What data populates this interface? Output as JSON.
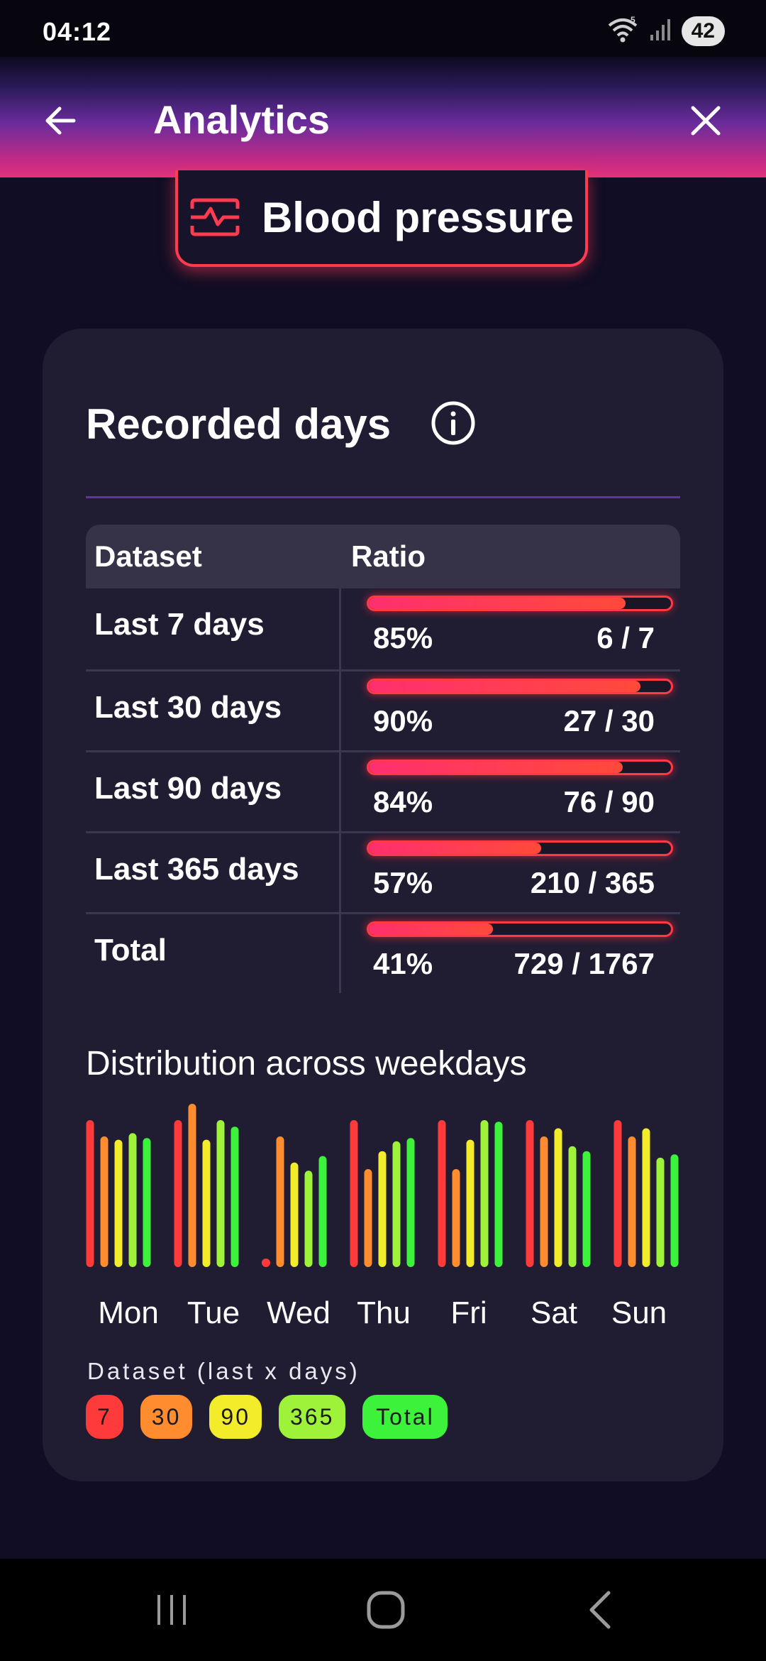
{
  "status": {
    "time": "04:12",
    "battery": "42",
    "wifi_badge": "5"
  },
  "appbar": {
    "title": "Analytics"
  },
  "metric": {
    "label": "Blood pressure",
    "icon": "heart-monitor-icon",
    "accent": "#ff3b4f"
  },
  "recorded": {
    "title": "Recorded days",
    "columns": {
      "dataset": "Dataset",
      "ratio": "Ratio"
    },
    "rows": [
      {
        "name": "Last 7 days",
        "percent": "85%",
        "count": "6 / 7",
        "fraction": 0.85
      },
      {
        "name": "Last 30 days",
        "percent": "90%",
        "count": "27 / 30",
        "fraction": 0.9
      },
      {
        "name": "Last 90 days",
        "percent": "84%",
        "count": "76 / 90",
        "fraction": 0.84
      },
      {
        "name": "Last 365 days",
        "percent": "57%",
        "count": "210 / 365",
        "fraction": 0.57
      },
      {
        "name": "Total",
        "percent": "41%",
        "count": "729 / 1767",
        "fraction": 0.41
      }
    ]
  },
  "chart_data": {
    "type": "bar",
    "title": "Distribution across weekdays",
    "categories": [
      "Mon",
      "Tue",
      "Wed",
      "Thu",
      "Fri",
      "Sat",
      "Sun"
    ],
    "ylim": [
      0,
      1
    ],
    "series": [
      {
        "name": "7",
        "color": "#ff3a3a",
        "values": [
          0.9,
          0.9,
          0.03,
          0.9,
          0.9,
          0.9,
          0.9
        ]
      },
      {
        "name": "30",
        "color": "#ff8c2e",
        "values": [
          0.8,
          1.0,
          0.8,
          0.6,
          0.6,
          0.8,
          0.8
        ]
      },
      {
        "name": "90",
        "color": "#f2ec2a",
        "values": [
          0.78,
          0.78,
          0.64,
          0.71,
          0.78,
          0.85,
          0.85
        ]
      },
      {
        "name": "365",
        "color": "#9ef23a",
        "values": [
          0.82,
          0.9,
          0.59,
          0.77,
          0.9,
          0.74,
          0.67
        ]
      },
      {
        "name": "Total",
        "color": "#3cf23a",
        "values": [
          0.79,
          0.86,
          0.68,
          0.79,
          0.89,
          0.71,
          0.69
        ]
      }
    ]
  },
  "legend": {
    "label": "Dataset (last x days)",
    "chips": [
      {
        "label": "7",
        "color": "#ff3a3a"
      },
      {
        "label": "30",
        "color": "#ff8c2e"
      },
      {
        "label": "90",
        "color": "#f2ec2a"
      },
      {
        "label": "365",
        "color": "#9ef23a"
      },
      {
        "label": "Total",
        "color": "#3cf23a"
      }
    ]
  }
}
